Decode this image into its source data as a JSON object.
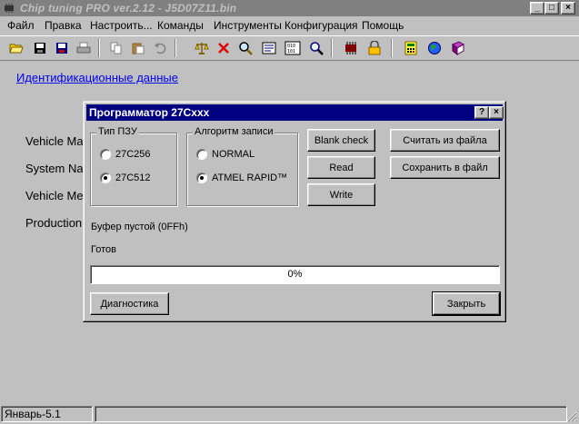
{
  "window": {
    "title": "Chip tuning PRO ver.2.12  -  J5D07Z11.bin"
  },
  "menu": [
    "Файл",
    "Правка",
    "Настроить...",
    "Команды",
    "Инструменты",
    "Конфигурация",
    "Помощь"
  ],
  "toolbar": {
    "buttons": [
      "open-icon",
      "save-icon",
      "save-as-icon",
      "print-icon",
      "copy-icon",
      "paste-icon",
      "undo-icon",
      "scales-icon",
      "delete-icon",
      "zoom-icon",
      "document-icon",
      "binary-icon",
      "find-icon",
      "chip-icon",
      "lock-icon",
      "calculator-icon",
      "web-icon",
      "book-icon"
    ]
  },
  "main": {
    "ident_link": "Идентификационные данные",
    "labels": [
      "Vehicle Ma",
      "System Na",
      "Vehicle Me",
      "Production"
    ]
  },
  "dialog": {
    "title": "Программатор 27Cxxx",
    "rom_type": {
      "legend": "Тип ПЗУ",
      "options": [
        "27C256",
        "27C512"
      ],
      "selected": "27C512"
    },
    "algorithm": {
      "legend": "Алгоритм записи",
      "options": [
        "NORMAL",
        "ATMEL RAPID™"
      ],
      "selected": "ATMEL RAPID™"
    },
    "buttons": {
      "blank_check": "Blank check",
      "read": "Read",
      "write": "Write",
      "read_file": "Считать из файла",
      "save_file": "Сохранить в файл",
      "diagnostics": "Диагностика",
      "close": "Закрыть"
    },
    "buffer_status": "Буфер пустой (0FFh)",
    "status": "Готов",
    "progress": {
      "percent": 0,
      "label": "0%"
    }
  },
  "statusbar": {
    "left": "Январь-5.1"
  }
}
